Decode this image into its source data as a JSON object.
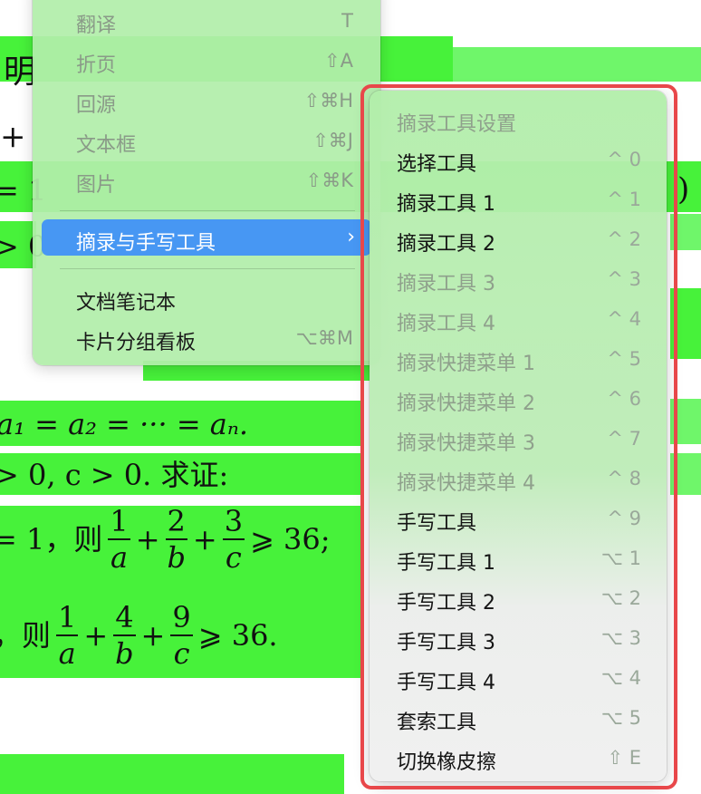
{
  "document": {
    "line_ming": "明",
    "line_plus": "+",
    "line_eq1": "= 1",
    "line_eq1_right": ")",
    "line_gt0": "> 0",
    "line_a_eq": "a₁ = a₂ = ··· = aₙ.",
    "line_c_gt": "> 0, c > 0. 求证:",
    "line_frac1_prefix": "= 1，则",
    "line_frac1_suffix": "⩾ 36;",
    "line_frac2_prefix": "，则",
    "line_frac2_suffix": "⩾ 36.",
    "frac1": [
      {
        "num": "1",
        "den": "a"
      },
      {
        "num": "2",
        "den": "b"
      },
      {
        "num": "3",
        "den": "c"
      }
    ],
    "frac2": [
      {
        "num": "1",
        "den": "a"
      },
      {
        "num": "4",
        "den": "b"
      },
      {
        "num": "9",
        "den": "c"
      }
    ],
    "plus": "+"
  },
  "main_menu": {
    "items": [
      {
        "label": "翻译",
        "shortcut": "T",
        "state": "disabled"
      },
      {
        "label": "折页",
        "shortcut": "⇧A",
        "state": "disabled"
      },
      {
        "label": "回源",
        "shortcut": "⇧⌘H",
        "state": "disabled"
      },
      {
        "label": "文本框",
        "shortcut": "⇧⌘J",
        "state": "disabled"
      },
      {
        "label": "图片",
        "shortcut": "⇧⌘K",
        "state": "disabled"
      },
      {
        "label": "摘录与手写工具",
        "shortcut": "›",
        "state": "active"
      },
      {
        "label": "文档笔记本",
        "shortcut": "",
        "state": "enabled"
      },
      {
        "label": "卡片分组看板",
        "shortcut": "⌥⌘M",
        "state": "enabled"
      }
    ]
  },
  "submenu": {
    "items": [
      {
        "label": "摘录工具设置",
        "shortcut": "",
        "state": "header"
      },
      {
        "label": "选择工具",
        "shortcut": "^ 0",
        "state": "enabled"
      },
      {
        "label": "摘录工具 1",
        "shortcut": "^ 1",
        "state": "enabled"
      },
      {
        "label": "摘录工具 2",
        "shortcut": "^ 2",
        "state": "enabled"
      },
      {
        "label": "摘录工具 3",
        "shortcut": "^ 3",
        "state": "disabled"
      },
      {
        "label": "摘录工具 4",
        "shortcut": "^ 4",
        "state": "disabled"
      },
      {
        "label": "摘录快捷菜单 1",
        "shortcut": "^ 5",
        "state": "disabled"
      },
      {
        "label": "摘录快捷菜单 2",
        "shortcut": "^ 6",
        "state": "disabled"
      },
      {
        "label": "摘录快捷菜单 3",
        "shortcut": "^ 7",
        "state": "disabled"
      },
      {
        "label": "摘录快捷菜单 4",
        "shortcut": "^ 8",
        "state": "disabled"
      },
      {
        "label": "手写工具",
        "shortcut": "^ 9",
        "state": "enabled"
      },
      {
        "label": "手写工具 1",
        "shortcut": "⌥ 1",
        "state": "enabled"
      },
      {
        "label": "手写工具 2",
        "shortcut": "⌥ 2",
        "state": "enabled"
      },
      {
        "label": "手写工具 3",
        "shortcut": "⌥ 3",
        "state": "enabled"
      },
      {
        "label": "手写工具 4",
        "shortcut": "⌥ 4",
        "state": "enabled"
      },
      {
        "label": "套索工具",
        "shortcut": "⌥ 5",
        "state": "enabled"
      },
      {
        "label": "切换橡皮擦",
        "shortcut": "⇧ E",
        "state": "enabled"
      }
    ]
  },
  "colors": {
    "highlight": "#47f23a",
    "menu_bg": "#b2eeaa",
    "active_item": "#4797f3",
    "annotation": "#e8474a"
  }
}
